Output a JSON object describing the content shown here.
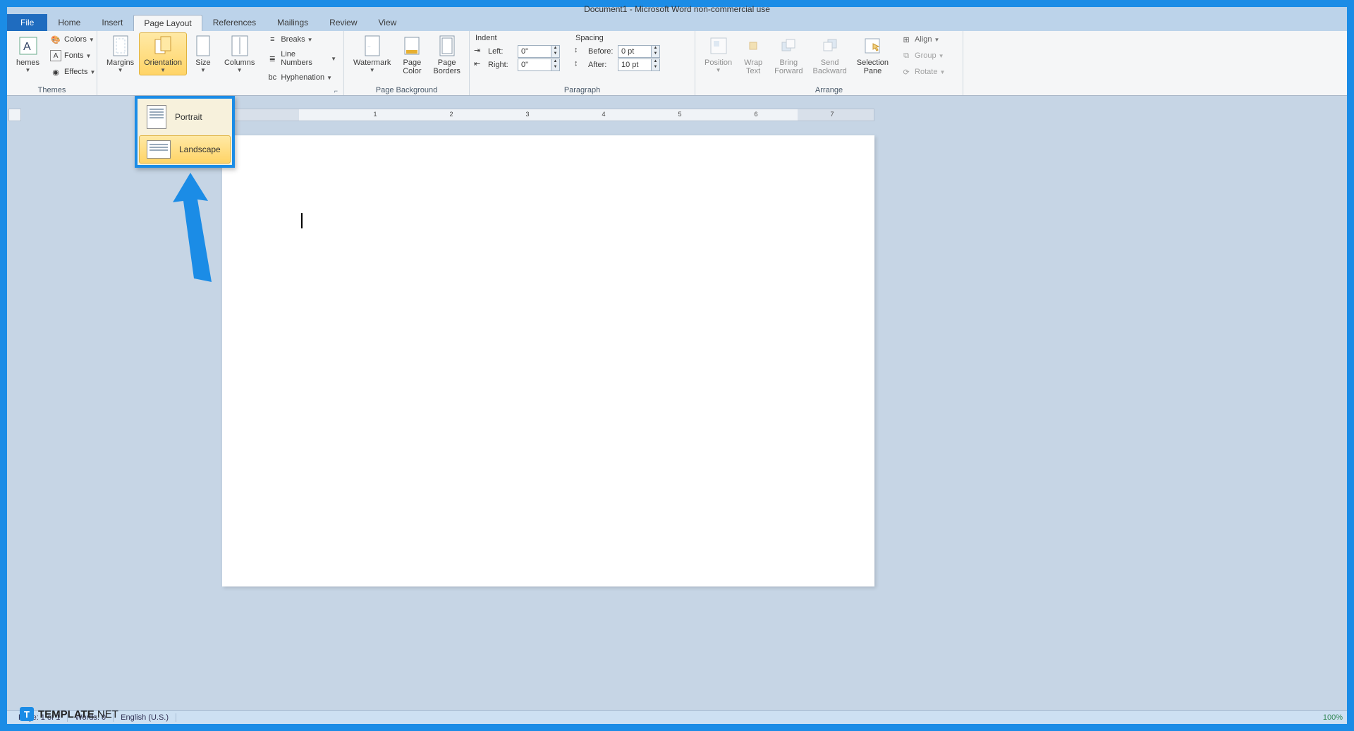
{
  "window": {
    "title": "Document1 - Microsoft Word non-commercial use"
  },
  "tabs": {
    "file": "File",
    "home": "Home",
    "insert": "Insert",
    "page_layout": "Page Layout",
    "references": "References",
    "mailings": "Mailings",
    "review": "Review",
    "view": "View"
  },
  "ribbon": {
    "themes": {
      "label": "Themes",
      "themes_btn": "hemes",
      "colors": "Colors",
      "fonts": "Fonts",
      "effects": "Effects"
    },
    "page_setup": {
      "margins": "Margins",
      "orientation": "Orientation",
      "size": "Size",
      "columns": "Columns",
      "breaks": "Breaks",
      "line_numbers": "Line Numbers",
      "hyphenation": "Hyphenation"
    },
    "page_background": {
      "label": "Page Background",
      "watermark": "Watermark",
      "page_color": "Page\nColor",
      "page_borders": "Page\nBorders"
    },
    "paragraph": {
      "label": "Paragraph",
      "indent_label": "Indent",
      "left_label": "Left:",
      "left_value": "0\"",
      "right_label": "Right:",
      "right_value": "0\"",
      "spacing_label": "Spacing",
      "before_label": "Before:",
      "before_value": "0 pt",
      "after_label": "After:",
      "after_value": "10 pt"
    },
    "arrange": {
      "label": "Arrange",
      "position": "Position",
      "wrap_text": "Wrap\nText",
      "bring_forward": "Bring\nForward",
      "send_backward": "Send\nBackward",
      "selection_pane": "Selection\nPane",
      "align": "Align",
      "group": "Group",
      "rotate": "Rotate"
    }
  },
  "orientation_dropdown": {
    "portrait": "Portrait",
    "landscape": "Landscape"
  },
  "statusbar": {
    "page": "Page: 1 of 1",
    "words": "Words: 0",
    "language": "English (U.S.)",
    "zoom": "100%"
  },
  "watermark_brand": {
    "bold": "TEMPLATE",
    "light": ".NET"
  },
  "ruler": {
    "numbers": [
      "1",
      "2",
      "3",
      "4",
      "5",
      "6",
      "7"
    ]
  }
}
